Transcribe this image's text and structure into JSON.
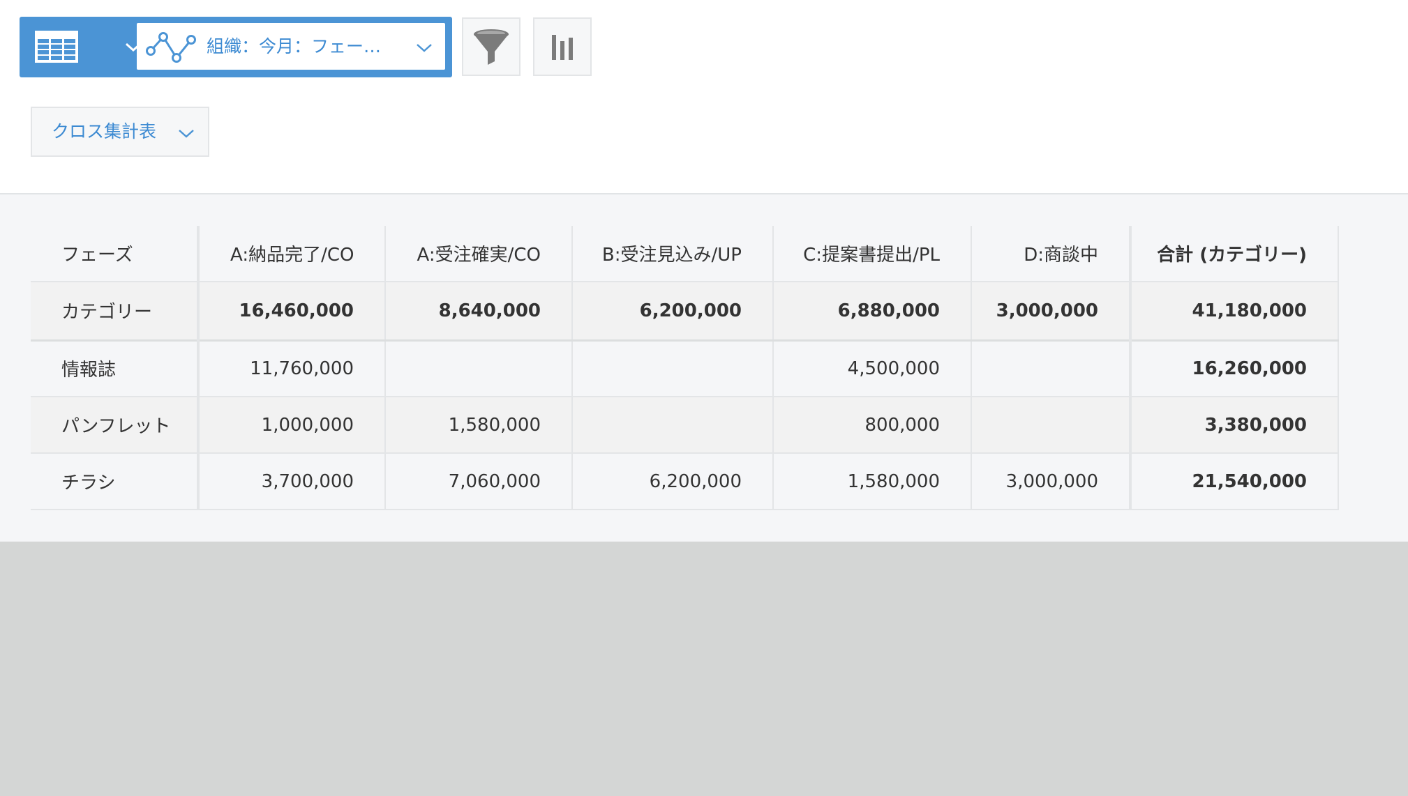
{
  "toolbar": {
    "table_icon": "table-icon",
    "graph_icon": "line-graph-icon",
    "report_label": "組織：今月：フェー…",
    "filter_icon": "funnel-icon",
    "chart_icon": "bar-chart-icon",
    "accent_color": "#4b94d5"
  },
  "chart_type_select": {
    "label": "クロス集計表"
  },
  "table": {
    "headers": [
      "フェーズ",
      "A:納品完了/CO",
      "A:受注確実/CO",
      "B:受注見込み/UP",
      "C:提案書提出/PL",
      "D:商談中",
      "合計 (カテゴリー)"
    ],
    "subtotal_row": [
      "カテゴリー",
      "16,460,000",
      "8,640,000",
      "6,200,000",
      "6,880,000",
      "3,000,000",
      "41,180,000"
    ],
    "rows": [
      [
        "情報誌",
        "11,760,000",
        "",
        "",
        "4,500,000",
        "",
        "16,260,000"
      ],
      [
        "パンフレット",
        "1,000,000",
        "1,580,000",
        "",
        "800,000",
        "",
        "3,380,000"
      ],
      [
        "チラシ",
        "3,700,000",
        "7,060,000",
        "6,200,000",
        "1,580,000",
        "3,000,000",
        "21,540,000"
      ]
    ]
  }
}
